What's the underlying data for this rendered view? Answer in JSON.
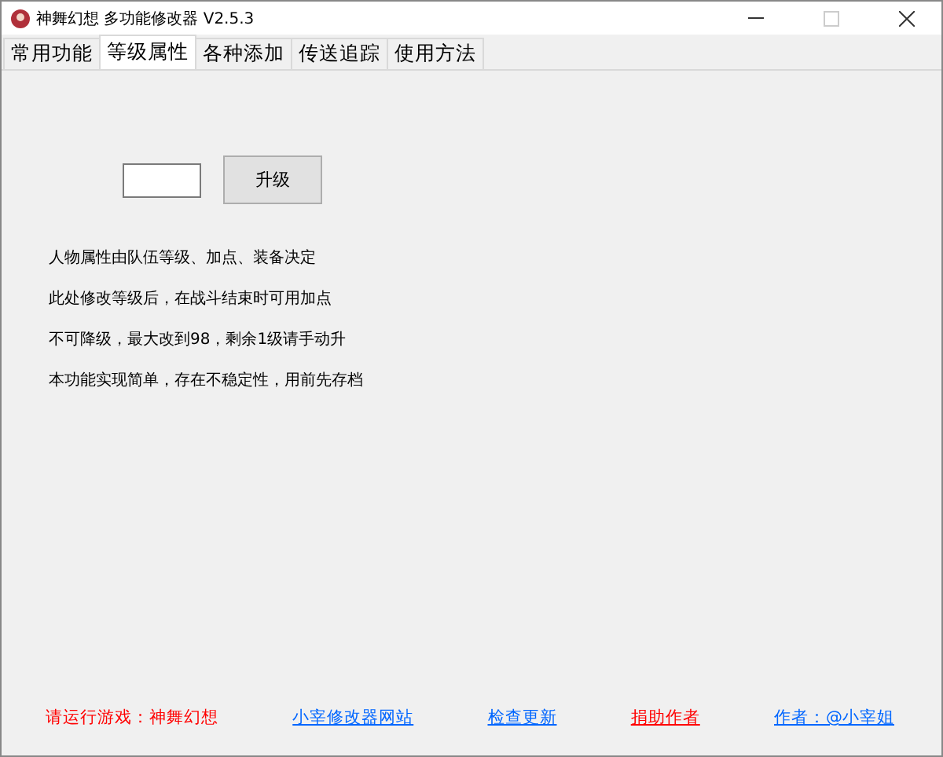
{
  "window": {
    "title": "神舞幻想 多功能修改器  V2.5.3",
    "maximize_disabled": true
  },
  "tabs": [
    {
      "label": "常用功能",
      "selected": false
    },
    {
      "label": "等级属性",
      "selected": true
    },
    {
      "label": "各种添加",
      "selected": false
    },
    {
      "label": "传送追踪",
      "selected": false
    },
    {
      "label": "使用方法",
      "selected": false
    }
  ],
  "upgrade_button": "升级",
  "notes": [
    "人物属性由队伍等级、加点、装备决定",
    "此处修改等级后，在战斗结束时可用加点",
    "不可降级，最大改到98，剩余1级请手动升",
    "本功能实现简单，存在不稳定性，用前先存档"
  ],
  "footer": [
    {
      "text": "请运行游戏：神舞幻想",
      "kind": "status",
      "color": "#ff0000"
    },
    {
      "text": "小宰修改器网站",
      "kind": "link",
      "color": "#0066ff"
    },
    {
      "text": "检查更新",
      "kind": "link",
      "color": "#0066ff"
    },
    {
      "text": "捐助作者",
      "kind": "link",
      "color": "#ff0000"
    },
    {
      "text": "作者：@小宰姐",
      "kind": "link",
      "color": "#0066ff"
    }
  ]
}
